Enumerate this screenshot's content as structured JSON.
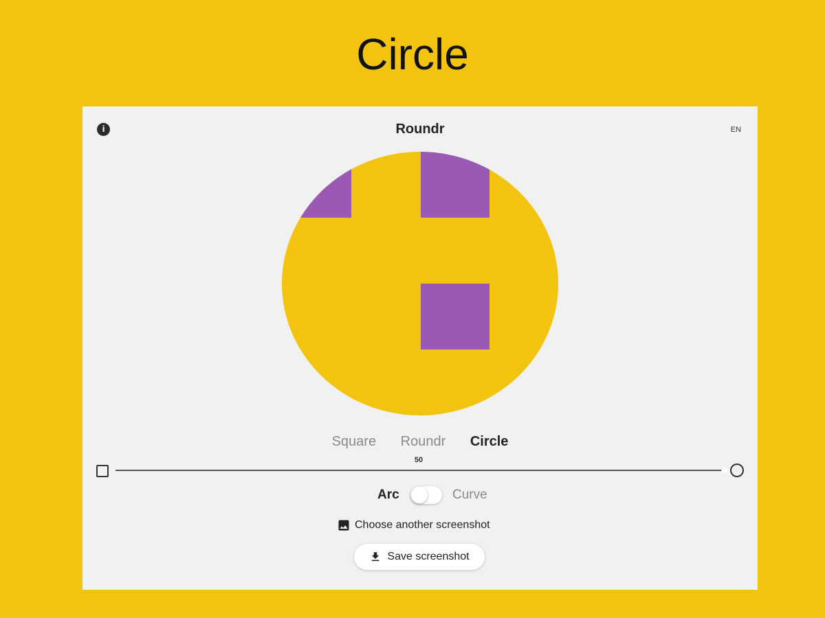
{
  "page": {
    "title": "Circle"
  },
  "colors": {
    "background": "#f2c40f",
    "card": "#f1f1f1",
    "shape_fill": "#f2c40f",
    "accent": "#9b59b6"
  },
  "app": {
    "title": "Roundr",
    "language": "EN",
    "info_icon": "info-icon"
  },
  "modes": [
    {
      "label": "Square",
      "active": false
    },
    {
      "label": "Roundr",
      "active": false
    },
    {
      "label": "Circle",
      "active": true
    }
  ],
  "slider": {
    "value": "50",
    "min_icon": "square-icon",
    "max_icon": "circle-icon"
  },
  "toggle": {
    "left_label": "Arc",
    "right_label": "Curve",
    "on": false
  },
  "actions": {
    "choose_label": "Choose another screenshot",
    "save_label": "Save screenshot"
  }
}
